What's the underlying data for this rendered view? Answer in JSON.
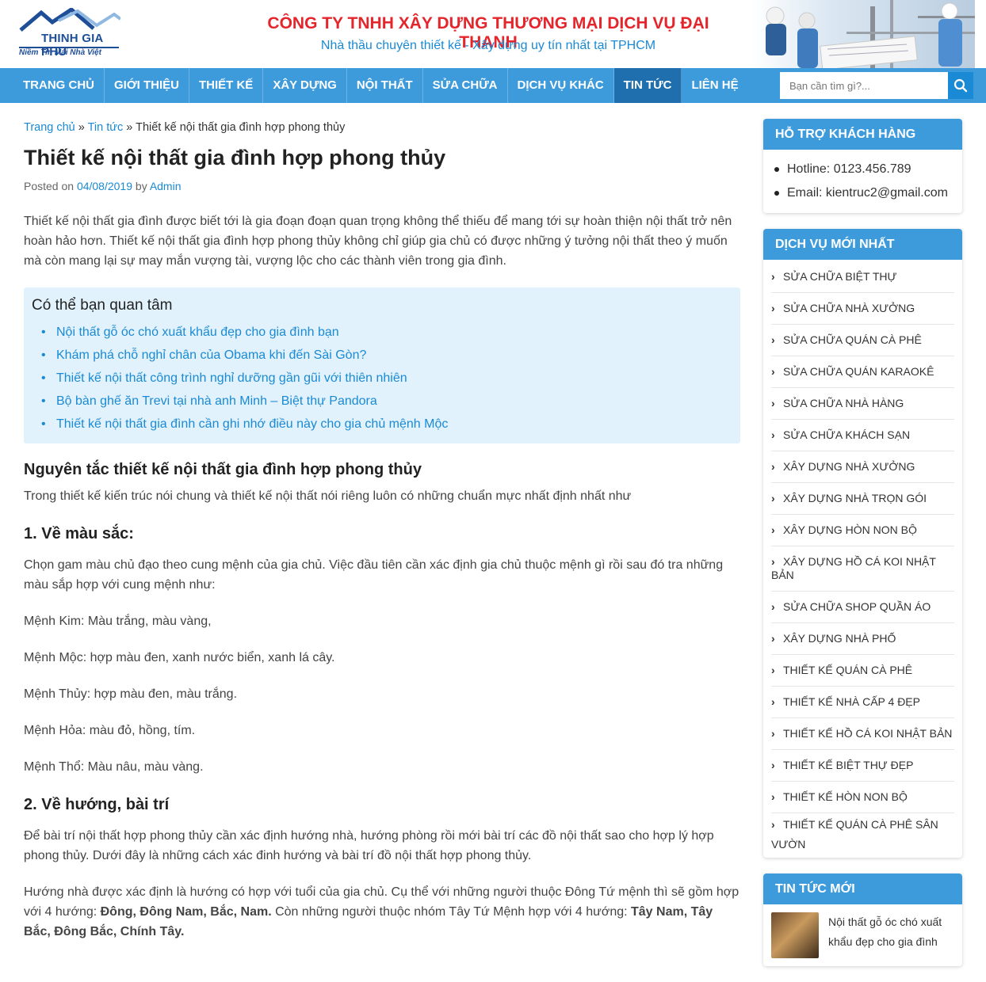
{
  "header": {
    "logo_name": "THINH GIA PHU",
    "logo_slogan": "Niềm Tin Mái Nhà Việt",
    "company_title": "CÔNG TY TNHH XÂY DỰNG THƯƠNG MẠI DỊCH VỤ ĐẠI THANH",
    "company_subtitle": "Nhà thầu chuyên thiết kế - Xây dựng uy tín nhất tại TPHCM"
  },
  "nav": {
    "items": [
      "TRANG CHỦ",
      "GIỚI THIỆU",
      "THIẾT KẾ",
      "XÂY DỰNG",
      "NỘI THẤT",
      "SỬA CHỮA",
      "DỊCH VỤ KHÁC",
      "TIN TỨC",
      "LIÊN HỆ"
    ],
    "active": "TIN TỨC",
    "search_placeholder": "Bạn cần tìm gì?..."
  },
  "breadcrumb": {
    "home": "Trang chủ",
    "sep1": " » ",
    "section": "Tin tức",
    "sep2": " » ",
    "current": "Thiết kế nội thất gia đình hợp phong thủy"
  },
  "post": {
    "title": "Thiết kế nội thất gia đình hợp phong thủy",
    "meta_prefix": "Posted on ",
    "date": "04/08/2019",
    "meta_by": " by ",
    "author": "Admin",
    "intro": "Thiết kế nội thất gia đình được biết tới là gia đoạn đoạn quan trọng không thể thiếu để mang tới sự hoàn thiện nội thất trở nên hoàn hảo hơn. Thiết kế nội thất gia đình hợp phong thủy không chỉ giúp gia chủ có được những ý tưởng nội thất theo ý muốn mà còn mang lại sự may mắn vượng tài, vượng lộc cho các thành viên trong gia đình.",
    "related_title": "Có thể bạn quan tâm",
    "related": [
      "Nội thất gỗ óc chó xuất khẩu đẹp cho gia đình bạn",
      "Khám phá chỗ nghỉ chân của Obama khi đến Sài Gòn?",
      "Thiết kế nội thất công trình nghỉ dưỡng gần gũi với thiên nhiên",
      "Bộ bàn ghế ăn Trevi tại nhà anh Minh – Biệt thự Pandora",
      "Thiết kế nội thất gia đình cần ghi nhớ điều này cho gia chủ mệnh Mộc"
    ],
    "h2": "Nguyên tắc thiết kế nội thất gia đình hợp phong thủy",
    "h2_text": "Trong thiết kế kiến trúc nói chung và thiết kế nội thất nói riêng luôn có những chuẩn mực nhất định nhất như",
    "h3_1": "1. Về màu sắc:",
    "colors_intro": "Chọn gam màu chủ đạo theo cung mệnh của gia chủ. Việc đầu tiên cần xác định gia chủ thuộc mệnh gì rồi sau đó tra những màu sắp hợp với cung mệnh như:",
    "elements": [
      "Mệnh Kim: Màu trắng, màu vàng,",
      "Mệnh Mộc: hợp màu đen, xanh nước biển, xanh lá cây.",
      "Mệnh Thủy: hợp màu đen, màu trắng.",
      "Mệnh Hỏa: màu đỏ, hồng, tím.",
      "Mệnh Thổ: Màu nâu, màu vàng."
    ],
    "h3_2": "2. Về hướng, bài trí",
    "direction_text": "Để bài trí nội thất hợp phong thủy cần xác định hướng nhà, hướng phòng rồi mới bài trí các đồ nội thất sao cho hợp lý hợp phong thủy. Dưới đây là những cách xác đinh hướng và bài trí đồ nội thất hợp phong thủy.",
    "house_dir_1": "Hướng nhà được xác định là hướng có hợp với tuổi của gia chủ. Cụ thể với những người thuộc Đông Tứ mệnh thì sẽ gồm hợp với 4 hướng: ",
    "house_dir_bold_1": "Đông, Đông Nam, Bắc, Nam.",
    "house_dir_2": " Còn những người thuộc nhóm Tây Tứ Mệnh hợp với 4 hướng: ",
    "house_dir_bold_2": "Tây Nam, Tây Bắc, Đông Bắc, Chính Tây."
  },
  "sidebar": {
    "support_title": "HỖ TRỢ KHÁCH HÀNG",
    "hotline": "Hotline: 0123.456.789",
    "email": "Email: kientruc2@gmail.com",
    "services_title": "DỊCH VỤ MỚI NHẤT",
    "services": [
      "SỬA CHỮA BIỆT THỰ",
      "SỬA CHỮA NHÀ XƯỞNG",
      "SỬA CHỮA QUÁN CÀ PHÊ",
      "SỬA CHỮA QUÁN KARAOKÊ",
      "SỬA CHỮA NHÀ HÀNG",
      "SỬA CHỮA KHÁCH SẠN",
      "XÂY DỰNG NHÀ XƯỞNG",
      "XÂY DỰNG NHÀ TRỌN GÓI",
      "XÂY DỰNG HÒN NON BỘ",
      "XÂY DỰNG HỒ CÁ KOI NHẬT BẢN",
      "SỬA CHỮA SHOP QUẦN ÁO",
      "XÂY DỰNG NHÀ PHỐ",
      "THIẾT KẾ QUÁN CÀ PHÊ",
      "THIẾT KẾ NHÀ CẤP 4 ĐẸP",
      "THIẾT KẾ HỒ CÁ KOI NHẬT BẢN",
      "THIẾT KẾ BIỆT THỰ ĐẸP",
      "THIẾT KẾ HÒN NON BỘ",
      "THIẾT KẾ QUÁN CÀ PHÊ SÂN VƯỜN"
    ],
    "news_title": "TIN TỨC MỚI",
    "news_item": "Nội thất gỗ óc chó xuất khẩu đẹp cho gia đình"
  }
}
